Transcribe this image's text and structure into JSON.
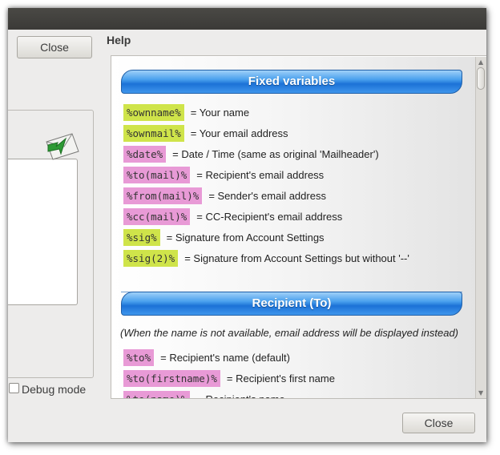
{
  "buttons": {
    "close_top": "Close",
    "close_bottom": "Close"
  },
  "left_panel": {
    "debug_label": "Debug mode",
    "debug_checked": false
  },
  "help": {
    "label": "Help",
    "sections": [
      {
        "title": "Fixed variables",
        "items": [
          {
            "code": "%ownname%",
            "color": "green",
            "desc": "= Your name"
          },
          {
            "code": "%ownmail%",
            "color": "green",
            "desc": "= Your email address"
          },
          {
            "code": "%date%",
            "color": "pink",
            "desc": "= Date / Time (same as original 'Mailheader')"
          },
          {
            "code": "%to(mail)%",
            "color": "pink",
            "desc": "= Recipient's email address"
          },
          {
            "code": "%from(mail)%",
            "color": "pink",
            "desc": "= Sender's email address"
          },
          {
            "code": "%cc(mail)%",
            "color": "pink",
            "desc": "= CC-Recipient's email address"
          },
          {
            "code": "%sig%",
            "color": "green",
            "desc": "= Signature from Account Settings"
          },
          {
            "code": "%sig(2)%",
            "color": "green",
            "desc": "= Signature from Account Settings but without '--'"
          }
        ]
      },
      {
        "title": "Recipient (To)",
        "note": "(When the name is not available, email address will be displayed instead)",
        "items": [
          {
            "code": "%to%",
            "color": "pink",
            "desc": "= Recipient's name (default)"
          },
          {
            "code": "%to(firstname)%",
            "color": "pink",
            "desc": "= Recipient's first name"
          },
          {
            "code": "%to(name)%",
            "color": "pink",
            "desc": "= Recipient's name"
          }
        ]
      }
    ]
  },
  "colors": {
    "code_green": "#cfe44a",
    "code_pink": "#e89ad6",
    "section_bar": "#1c72d7",
    "titlebar": "#3c3b37"
  }
}
